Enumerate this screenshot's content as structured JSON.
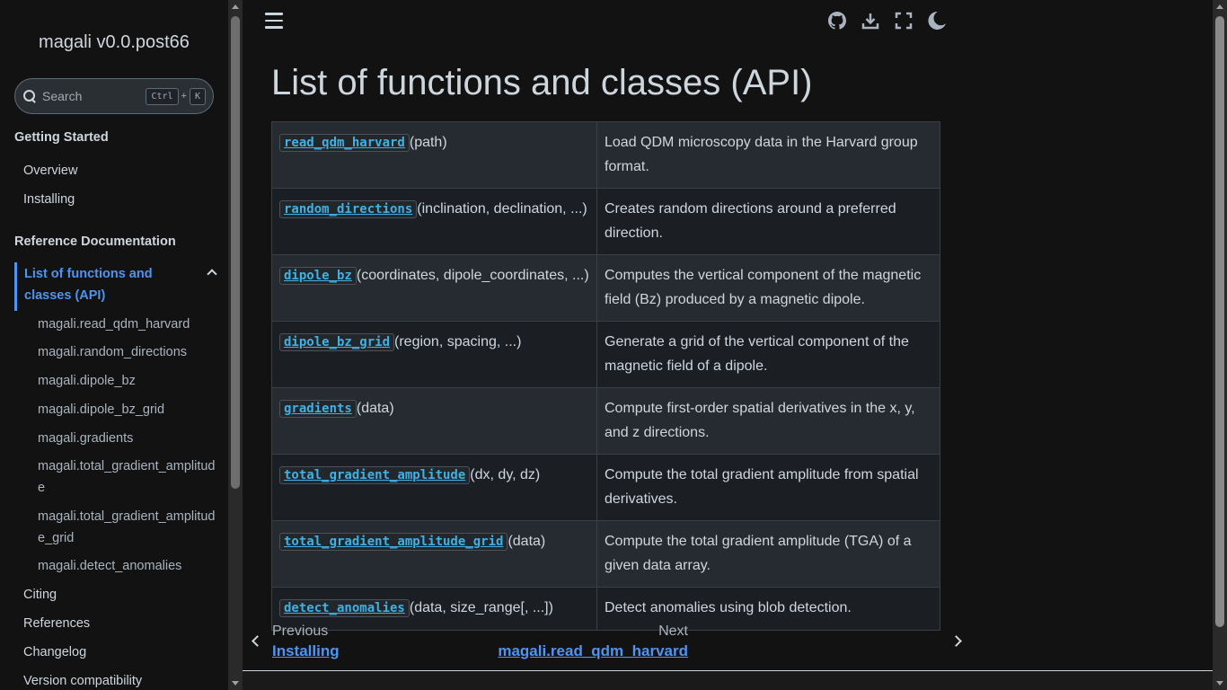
{
  "sidebar": {
    "brand": "magali v0.0.post66",
    "search": {
      "placeholder": "Search",
      "key1": "Ctrl",
      "plus": "+",
      "key2": "K"
    },
    "sections": [
      {
        "caption": "Getting Started",
        "items": [
          "Overview",
          "Installing"
        ]
      },
      {
        "caption": "Reference Documentation",
        "active": "List of functions and classes (API)",
        "subitems": [
          "magali.read_qdm_harvard",
          "magali.random_directions",
          "magali.dipole_bz",
          "magali.dipole_bz_grid",
          "magali.gradients",
          "magali.total_gradient_amplitude",
          "magali.total_gradient_amplitude_grid",
          "magali.detect_anomalies"
        ],
        "items": [
          "Citing",
          "References",
          "Changelog",
          "Version compatibility"
        ]
      }
    ]
  },
  "header": {
    "icons": [
      "github-icon",
      "download-icon",
      "fullscreen-icon",
      "dark-mode-icon"
    ]
  },
  "main": {
    "title": "List of functions and classes (API)",
    "rows": [
      {
        "name": "read_qdm_harvard",
        "args": "(path)",
        "desc": "Load QDM microscopy data in the Harvard group format."
      },
      {
        "name": "random_directions",
        "args": "(inclination, declination, ...)",
        "desc": "Creates random directions around a preferred direction."
      },
      {
        "name": "dipole_bz",
        "args": "(coordinates, dipole_coordinates, ...)",
        "desc": "Computes the vertical component of the magnetic field (Bz) produced by a magnetic dipole."
      },
      {
        "name": "dipole_bz_grid",
        "args": "(region, spacing, ...)",
        "desc": "Generate a grid of the vertical component of the magnetic field of a dipole."
      },
      {
        "name": "gradients",
        "args": "(data)",
        "desc": "Compute first-order spatial derivatives in the x, y, and z directions."
      },
      {
        "name": "total_gradient_amplitude",
        "args": "(dx, dy, dz)",
        "desc": "Compute the total gradient amplitude from spatial derivatives."
      },
      {
        "name": "total_gradient_amplitude_grid",
        "args": "(data)",
        "desc": "Compute the total gradient amplitude (TGA) of a given data array."
      },
      {
        "name": "detect_anomalies",
        "args": "(data, size_range[, ...])",
        "desc": "Detect anomalies using blob detection."
      }
    ]
  },
  "pager": {
    "prev_label": "Previous",
    "prev_title": "Installing",
    "next_label": "Next",
    "next_title": "magali.read_qdm_harvard"
  },
  "colors": {
    "accent": "#4e94f0",
    "code": "#3fb1e5",
    "background": "#121212"
  }
}
